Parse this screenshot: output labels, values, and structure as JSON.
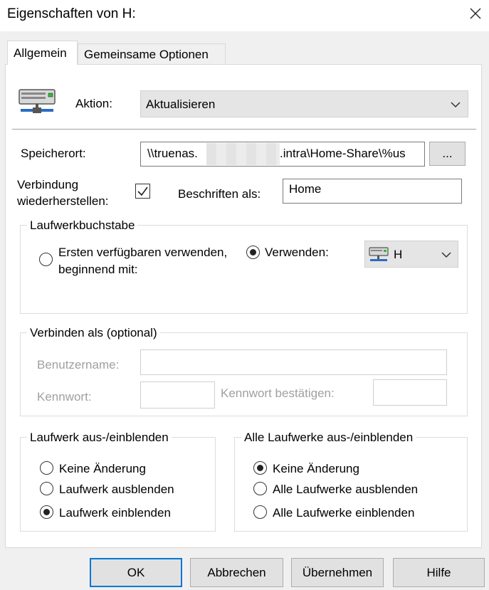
{
  "window": {
    "title": "Eigenschaften von H:",
    "close_icon": "close-icon"
  },
  "tabs": [
    {
      "label": "Allgemein",
      "active": true
    },
    {
      "label": "Gemeinsame Optionen",
      "active": false
    }
  ],
  "action": {
    "label": "Aktion:",
    "value": "Aktualisieren"
  },
  "location": {
    "label": "Speicherort:",
    "value_prefix": "\\\\truenas.",
    "value_suffix": ".intra\\Home-Share\\%us",
    "browse_label": "..."
  },
  "reconnect": {
    "label_line1": "Verbindung",
    "label_line2": "wiederherstellen:",
    "checked": true
  },
  "label_as": {
    "label": "Beschriften als:",
    "value": "Home"
  },
  "drive_letter": {
    "title": "Laufwerkbuchstabe",
    "first_available_line1": "Ersten verfügbaren verwenden,",
    "first_available_line2": "beginnend mit:",
    "use_label": "Verwenden:",
    "letter": "H",
    "selected": "use"
  },
  "connect_as": {
    "title": "Verbinden als (optional)",
    "username_label": "Benutzername:",
    "password_label": "Kennwort:",
    "confirm_label": "Kennwort bestätigen:"
  },
  "show_hide_drive": {
    "title": "Laufwerk aus-/einblenden",
    "options": [
      "Keine Änderung",
      "Laufwerk ausblenden",
      "Laufwerk einblenden"
    ],
    "selected_index": 2
  },
  "show_hide_all": {
    "title": "Alle Laufwerke aus-/einblenden",
    "options": [
      "Keine Änderung",
      "Alle Laufwerke ausblenden",
      "Alle Laufwerke einblenden"
    ],
    "selected_index": 0
  },
  "buttons": {
    "ok": "OK",
    "cancel": "Abbrechen",
    "apply": "Übernehmen",
    "help": "Hilfe"
  },
  "colors": {
    "accent": "#0078d7"
  }
}
